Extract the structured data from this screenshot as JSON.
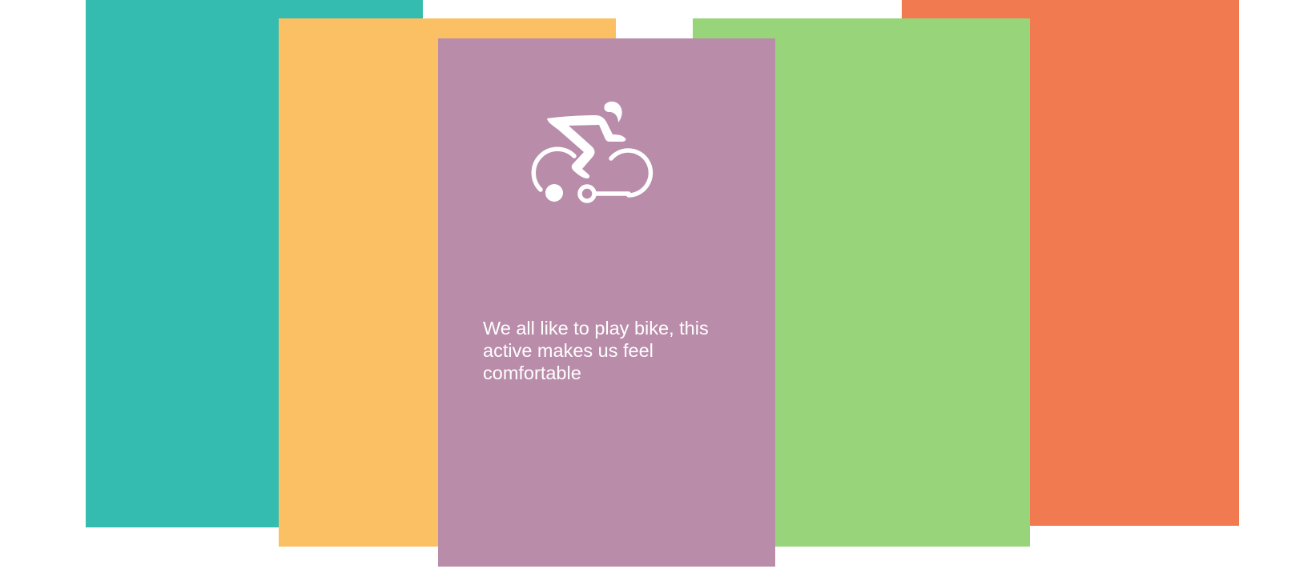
{
  "colors": {
    "background": "#ffffff",
    "teal": "#34bcb1",
    "yellow": "#fbc064",
    "purple": "#b98caa",
    "green": "#98d479",
    "orange": "#f27a50",
    "text": "#ffffff"
  },
  "cards": [
    {
      "id": "card-teal",
      "color": "#34bcb1"
    },
    {
      "id": "card-orange",
      "color": "#f27a50"
    },
    {
      "id": "card-yellow",
      "color": "#fbc064"
    },
    {
      "id": "card-green",
      "color": "#98d479"
    },
    {
      "id": "card-purple",
      "color": "#b98caa",
      "icon": "cyclist-icon"
    }
  ],
  "featured_card": {
    "icon": "cyclist-icon",
    "caption": "We all like to play bike, this active makes us feel comfortable"
  }
}
